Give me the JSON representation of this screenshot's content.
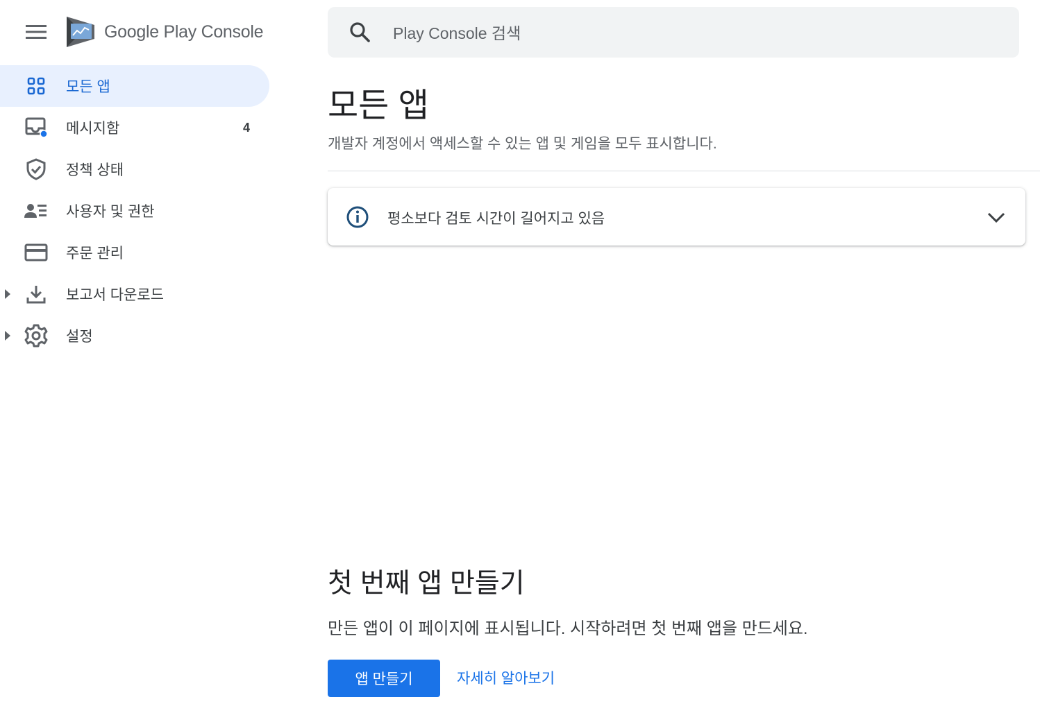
{
  "app": {
    "logo_text_main": "Google Play",
    "logo_text_sub": "Console",
    "brand_color": "#1a73e8"
  },
  "header": {
    "menu_icon": "hamburger-menu-icon",
    "search": {
      "placeholder": "Play Console 검색",
      "icon": "search-icon"
    }
  },
  "sidebar": {
    "items": [
      {
        "label": "모든 앱",
        "icon": "grid-apps-icon",
        "active": true
      },
      {
        "label": "메시지함",
        "icon": "inbox-icon",
        "count": "4",
        "has_dot": true
      },
      {
        "label": "정책 상태",
        "icon": "shield-check-icon"
      },
      {
        "label": "사용자 및 권한",
        "icon": "users-list-icon"
      },
      {
        "label": "주문 관리",
        "icon": "credit-card-icon"
      },
      {
        "label": "보고서 다운로드",
        "icon": "download-icon",
        "expandable": true
      },
      {
        "label": "설정",
        "icon": "gear-icon",
        "expandable": true
      }
    ]
  },
  "main": {
    "title": "모든 앱",
    "subtitle": "개발자 계정에서 액세스할 수 있는 앱 및 게임을 모두 표시합니다.",
    "notice": {
      "text": "평소보다 검토 시간이 길어지고 있음",
      "icon": "info-icon",
      "expand_icon": "chevron-down-icon"
    },
    "empty_state": {
      "title": "첫 번째 앱 만들기",
      "description": "만든 앱이 이 페이지에 표시됩니다. 시작하려면 첫 번째 앱을 만드세요.",
      "primary_button": "앱 만들기",
      "link": "자세히 알아보기"
    }
  }
}
